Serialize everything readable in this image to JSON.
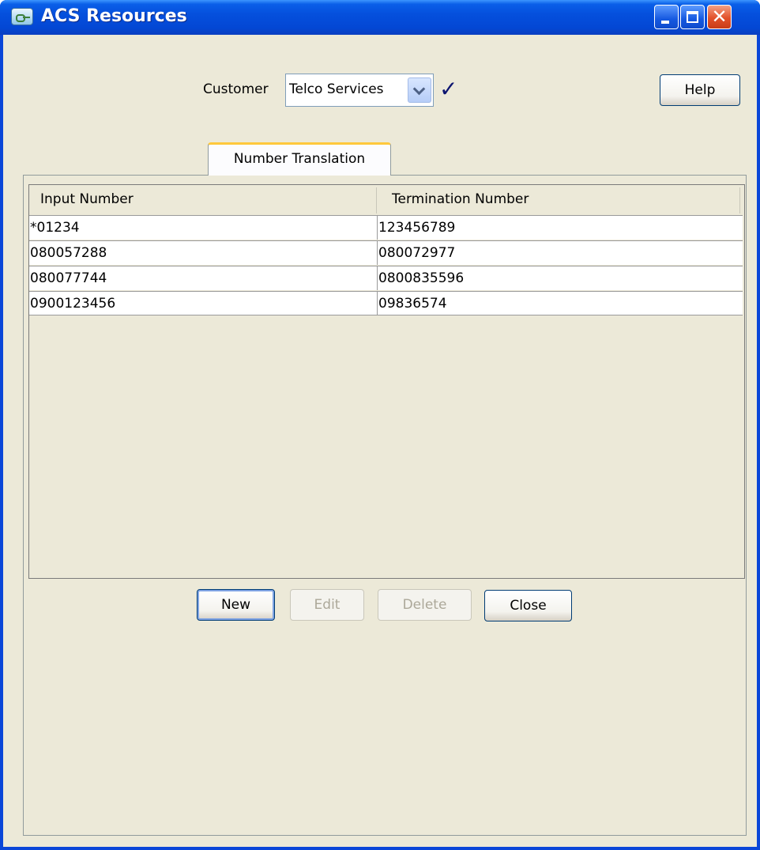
{
  "window": {
    "title": "ACS Resources",
    "icon": "key-card-icon"
  },
  "titlebar_buttons": [
    "minimize-icon",
    "maximize-icon",
    "close-icon"
  ],
  "customer": {
    "label": "Customer",
    "selected": "Telco Services"
  },
  "help_label": "Help",
  "tab": {
    "label": "Number Translation"
  },
  "table": {
    "columns": [
      "Input Number",
      "Termination Number"
    ],
    "rows": [
      [
        "*01234",
        "123456789"
      ],
      [
        "080057288",
        "080072977"
      ],
      [
        "080077744",
        "0800835596"
      ],
      [
        "0900123456",
        "09836574"
      ]
    ]
  },
  "buttons": {
    "new": "New",
    "edit": "Edit",
    "delete": "Delete",
    "close": "Close"
  },
  "colors": {
    "titlebar": "#0a5fe8",
    "window_bg": "#ece9d8",
    "tab_highlight": "#ffc83c",
    "close_button": "#e2512a"
  }
}
